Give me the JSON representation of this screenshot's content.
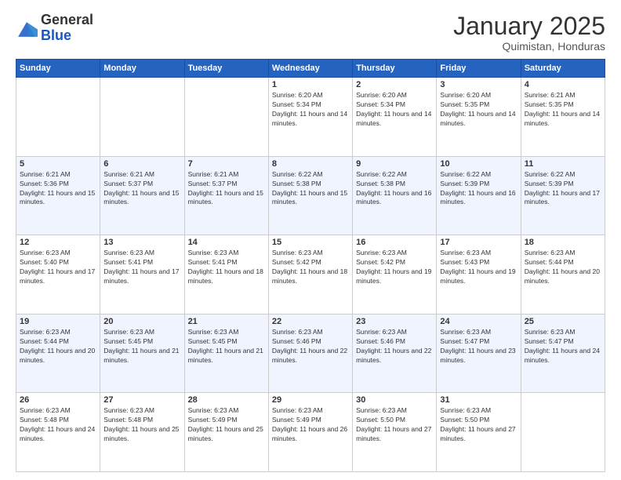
{
  "logo": {
    "general": "General",
    "blue": "Blue"
  },
  "header": {
    "month": "January 2025",
    "location": "Quimistan, Honduras"
  },
  "days_of_week": [
    "Sunday",
    "Monday",
    "Tuesday",
    "Wednesday",
    "Thursday",
    "Friday",
    "Saturday"
  ],
  "weeks": [
    [
      {
        "day": "",
        "info": ""
      },
      {
        "day": "",
        "info": ""
      },
      {
        "day": "",
        "info": ""
      },
      {
        "day": "1",
        "info": "Sunrise: 6:20 AM\nSunset: 5:34 PM\nDaylight: 11 hours and 14 minutes."
      },
      {
        "day": "2",
        "info": "Sunrise: 6:20 AM\nSunset: 5:34 PM\nDaylight: 11 hours and 14 minutes."
      },
      {
        "day": "3",
        "info": "Sunrise: 6:20 AM\nSunset: 5:35 PM\nDaylight: 11 hours and 14 minutes."
      },
      {
        "day": "4",
        "info": "Sunrise: 6:21 AM\nSunset: 5:35 PM\nDaylight: 11 hours and 14 minutes."
      }
    ],
    [
      {
        "day": "5",
        "info": "Sunrise: 6:21 AM\nSunset: 5:36 PM\nDaylight: 11 hours and 15 minutes."
      },
      {
        "day": "6",
        "info": "Sunrise: 6:21 AM\nSunset: 5:37 PM\nDaylight: 11 hours and 15 minutes."
      },
      {
        "day": "7",
        "info": "Sunrise: 6:21 AM\nSunset: 5:37 PM\nDaylight: 11 hours and 15 minutes."
      },
      {
        "day": "8",
        "info": "Sunrise: 6:22 AM\nSunset: 5:38 PM\nDaylight: 11 hours and 15 minutes."
      },
      {
        "day": "9",
        "info": "Sunrise: 6:22 AM\nSunset: 5:38 PM\nDaylight: 11 hours and 16 minutes."
      },
      {
        "day": "10",
        "info": "Sunrise: 6:22 AM\nSunset: 5:39 PM\nDaylight: 11 hours and 16 minutes."
      },
      {
        "day": "11",
        "info": "Sunrise: 6:22 AM\nSunset: 5:39 PM\nDaylight: 11 hours and 17 minutes."
      }
    ],
    [
      {
        "day": "12",
        "info": "Sunrise: 6:23 AM\nSunset: 5:40 PM\nDaylight: 11 hours and 17 minutes."
      },
      {
        "day": "13",
        "info": "Sunrise: 6:23 AM\nSunset: 5:41 PM\nDaylight: 11 hours and 17 minutes."
      },
      {
        "day": "14",
        "info": "Sunrise: 6:23 AM\nSunset: 5:41 PM\nDaylight: 11 hours and 18 minutes."
      },
      {
        "day": "15",
        "info": "Sunrise: 6:23 AM\nSunset: 5:42 PM\nDaylight: 11 hours and 18 minutes."
      },
      {
        "day": "16",
        "info": "Sunrise: 6:23 AM\nSunset: 5:42 PM\nDaylight: 11 hours and 19 minutes."
      },
      {
        "day": "17",
        "info": "Sunrise: 6:23 AM\nSunset: 5:43 PM\nDaylight: 11 hours and 19 minutes."
      },
      {
        "day": "18",
        "info": "Sunrise: 6:23 AM\nSunset: 5:44 PM\nDaylight: 11 hours and 20 minutes."
      }
    ],
    [
      {
        "day": "19",
        "info": "Sunrise: 6:23 AM\nSunset: 5:44 PM\nDaylight: 11 hours and 20 minutes."
      },
      {
        "day": "20",
        "info": "Sunrise: 6:23 AM\nSunset: 5:45 PM\nDaylight: 11 hours and 21 minutes."
      },
      {
        "day": "21",
        "info": "Sunrise: 6:23 AM\nSunset: 5:45 PM\nDaylight: 11 hours and 21 minutes."
      },
      {
        "day": "22",
        "info": "Sunrise: 6:23 AM\nSunset: 5:46 PM\nDaylight: 11 hours and 22 minutes."
      },
      {
        "day": "23",
        "info": "Sunrise: 6:23 AM\nSunset: 5:46 PM\nDaylight: 11 hours and 22 minutes."
      },
      {
        "day": "24",
        "info": "Sunrise: 6:23 AM\nSunset: 5:47 PM\nDaylight: 11 hours and 23 minutes."
      },
      {
        "day": "25",
        "info": "Sunrise: 6:23 AM\nSunset: 5:47 PM\nDaylight: 11 hours and 24 minutes."
      }
    ],
    [
      {
        "day": "26",
        "info": "Sunrise: 6:23 AM\nSunset: 5:48 PM\nDaylight: 11 hours and 24 minutes."
      },
      {
        "day": "27",
        "info": "Sunrise: 6:23 AM\nSunset: 5:48 PM\nDaylight: 11 hours and 25 minutes."
      },
      {
        "day": "28",
        "info": "Sunrise: 6:23 AM\nSunset: 5:49 PM\nDaylight: 11 hours and 25 minutes."
      },
      {
        "day": "29",
        "info": "Sunrise: 6:23 AM\nSunset: 5:49 PM\nDaylight: 11 hours and 26 minutes."
      },
      {
        "day": "30",
        "info": "Sunrise: 6:23 AM\nSunset: 5:50 PM\nDaylight: 11 hours and 27 minutes."
      },
      {
        "day": "31",
        "info": "Sunrise: 6:23 AM\nSunset: 5:50 PM\nDaylight: 11 hours and 27 minutes."
      },
      {
        "day": "",
        "info": ""
      }
    ]
  ]
}
